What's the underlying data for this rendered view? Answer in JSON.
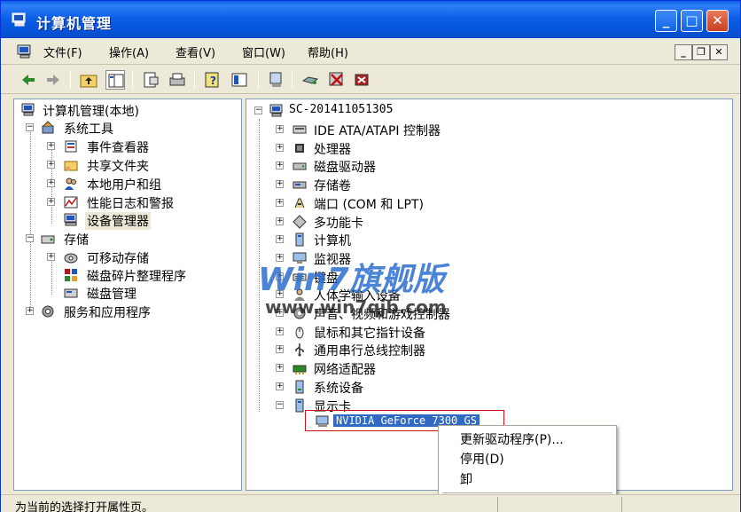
{
  "window": {
    "title": "计算机管理",
    "controls": {
      "minimize": "_",
      "maximize": "□",
      "close": "✕"
    }
  },
  "menubar": {
    "items": [
      "文件(F)",
      "操作(A)",
      "查看(V)",
      "窗口(W)",
      "帮助(H)"
    ],
    "mdi": {
      "minimize": "_",
      "restore": "❐",
      "close": "✕"
    }
  },
  "toolbar": {
    "icons": [
      "back-icon",
      "forward-icon",
      "up-folder-icon",
      "show-tree-icon",
      "properties-icon",
      "print-icon",
      "help-icon",
      "console-icon",
      "scan-hardware-icon",
      "update-driver-icon",
      "disable-device-icon",
      "uninstall-device-icon"
    ]
  },
  "left_tree": {
    "items": [
      {
        "label": "计算机管理(本地)",
        "level": 0,
        "expander": "",
        "icon": "computer-icon"
      },
      {
        "label": "系统工具",
        "level": 1,
        "expander": "−",
        "icon": "tools-icon"
      },
      {
        "label": "事件查看器",
        "level": 2,
        "expander": "+",
        "icon": "event-viewer-icon"
      },
      {
        "label": "共享文件夹",
        "level": 2,
        "expander": "+",
        "icon": "shared-folder-icon"
      },
      {
        "label": "本地用户和组",
        "level": 2,
        "expander": "+",
        "icon": "users-icon"
      },
      {
        "label": "性能日志和警报",
        "level": 2,
        "expander": "+",
        "icon": "performance-icon"
      },
      {
        "label": "设备管理器",
        "level": 2,
        "expander": "",
        "icon": "device-manager-icon",
        "selected": true
      },
      {
        "label": "存储",
        "level": 1,
        "expander": "−",
        "icon": "storage-icon"
      },
      {
        "label": "可移动存储",
        "level": 2,
        "expander": "+",
        "icon": "removable-storage-icon"
      },
      {
        "label": "磁盘碎片整理程序",
        "level": 2,
        "expander": "",
        "icon": "defrag-icon"
      },
      {
        "label": "磁盘管理",
        "level": 2,
        "expander": "",
        "icon": "disk-management-icon"
      },
      {
        "label": "服务和应用程序",
        "level": 1,
        "expander": "+",
        "icon": "services-icon"
      }
    ]
  },
  "right_tree": {
    "root": "SC-201411051305",
    "items": [
      {
        "label": "IDE ATA/ATAPI 控制器",
        "expander": "+",
        "icon": "ide-controller-icon"
      },
      {
        "label": "处理器",
        "expander": "+",
        "icon": "processor-icon"
      },
      {
        "label": "磁盘驱动器",
        "expander": "+",
        "icon": "disk-drive-icon"
      },
      {
        "label": "存储卷",
        "expander": "+",
        "icon": "storage-volume-icon"
      },
      {
        "label": "端口 (COM 和 LPT)",
        "expander": "+",
        "icon": "port-icon"
      },
      {
        "label": "多功能卡",
        "expander": "+",
        "icon": "multifunction-card-icon"
      },
      {
        "label": "计算机",
        "expander": "+",
        "icon": "computer-icon"
      },
      {
        "label": "监视器",
        "expander": "+",
        "icon": "monitor-icon"
      },
      {
        "label": "键盘",
        "expander": "+",
        "icon": "keyboard-icon"
      },
      {
        "label": "人体学输入设备",
        "expander": "+",
        "icon": "hid-icon"
      },
      {
        "label": "声音、视频和游戏控制器",
        "expander": "+",
        "icon": "sound-icon"
      },
      {
        "label": "鼠标和其它指针设备",
        "expander": "+",
        "icon": "mouse-icon"
      },
      {
        "label": "通用串行总线控制器",
        "expander": "+",
        "icon": "usb-icon"
      },
      {
        "label": "网络适配器",
        "expander": "+",
        "icon": "network-adapter-icon"
      },
      {
        "label": "系统设备",
        "expander": "+",
        "icon": "system-device-icon"
      },
      {
        "label": "显示卡",
        "expander": "−",
        "icon": "display-adapter-icon"
      }
    ],
    "child": {
      "label": "NVIDIA GeForce 7300 GS",
      "icon": "display-adapter-icon"
    }
  },
  "watermark": {
    "brand": "Win7旗舰版",
    "url": "www.win7qjb.com"
  },
  "context_menu": {
    "items": [
      "更新驱动程序(P)...",
      "停用(D)",
      "卸",
      "扫"
    ]
  },
  "statusbar": {
    "text": "为当前的选择打开属性页。"
  },
  "colors": {
    "title_bar": "#0652d6",
    "selection": "#316ac5",
    "highlight_box": "#d01010"
  }
}
